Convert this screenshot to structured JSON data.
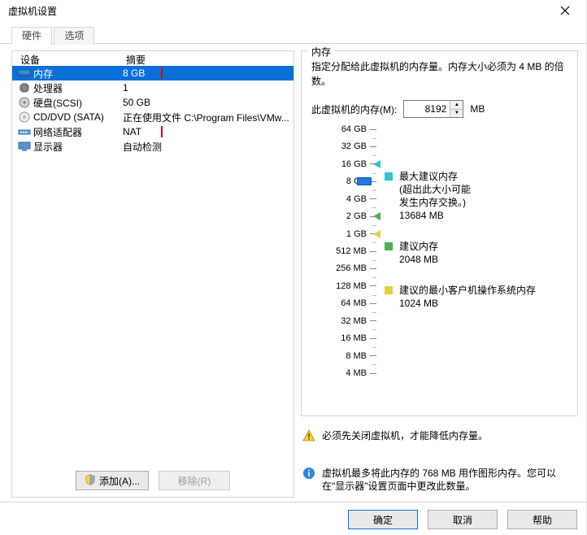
{
  "title": "虚拟机设置",
  "tabs": {
    "hardware": "硬件",
    "options": "选项",
    "active": "hardware"
  },
  "columns": {
    "device": "设备",
    "summary": "摘要"
  },
  "devices": [
    {
      "id": "memory",
      "icon": "memory-icon",
      "name": "内存",
      "summary": "8 GB",
      "highlight_summary": true,
      "selected": true
    },
    {
      "id": "cpu",
      "icon": "cpu-icon",
      "name": "处理器",
      "summary": "1"
    },
    {
      "id": "disk",
      "icon": "disk-icon",
      "name": "硬盘(SCSI)",
      "summary": "50 GB"
    },
    {
      "id": "cddvd",
      "icon": "cddvd-icon",
      "name": "CD/DVD (SATA)",
      "summary": "正在使用文件 C:\\Program Files\\VMw..."
    },
    {
      "id": "net",
      "icon": "network-icon",
      "name": "网络适配器",
      "summary": "NAT",
      "highlight_summary": true
    },
    {
      "id": "display",
      "icon": "display-icon",
      "name": "显示器",
      "summary": "自动检测"
    }
  ],
  "add_remove": {
    "add": "添加(A)...",
    "remove": "移除(R)"
  },
  "memory": {
    "fieldset_title": "内存",
    "desc": "指定分配给此虚拟机的内存量。内存大小必须为 4 MB 的倍数。",
    "input_label": "此虚拟机的内存(M):",
    "value": "8192",
    "unit": "MB",
    "ruler_labels": [
      "64 GB",
      "32 GB",
      "16 GB",
      "8 GB",
      "4 GB",
      "2 GB",
      "1 GB",
      "512 MB",
      "256 MB",
      "128 MB",
      "64 MB",
      "32 MB",
      "16 MB",
      "8 MB",
      "4 MB"
    ],
    "markers": {
      "max": 2,
      "rec": 5,
      "min": 6,
      "thumb": 3
    },
    "legend": {
      "max": {
        "title": "最大建议内存",
        "note1": "(超出此大小可能",
        "note2": "发生内存交换。)",
        "value": "13684 MB"
      },
      "rec": {
        "title": "建议内存",
        "value": "2048 MB"
      },
      "min": {
        "title": "建议的最小客户机操作系统内存",
        "value": "1024 MB"
      }
    },
    "warning": "必须先关闭虚拟机，才能降低内存量。",
    "info": "虚拟机最多将此内存的 768 MB 用作图形内存。您可以在\"显示器\"设置页面中更改此数量。"
  },
  "dialog_buttons": {
    "ok": "确定",
    "cancel": "取消",
    "help": "帮助"
  }
}
